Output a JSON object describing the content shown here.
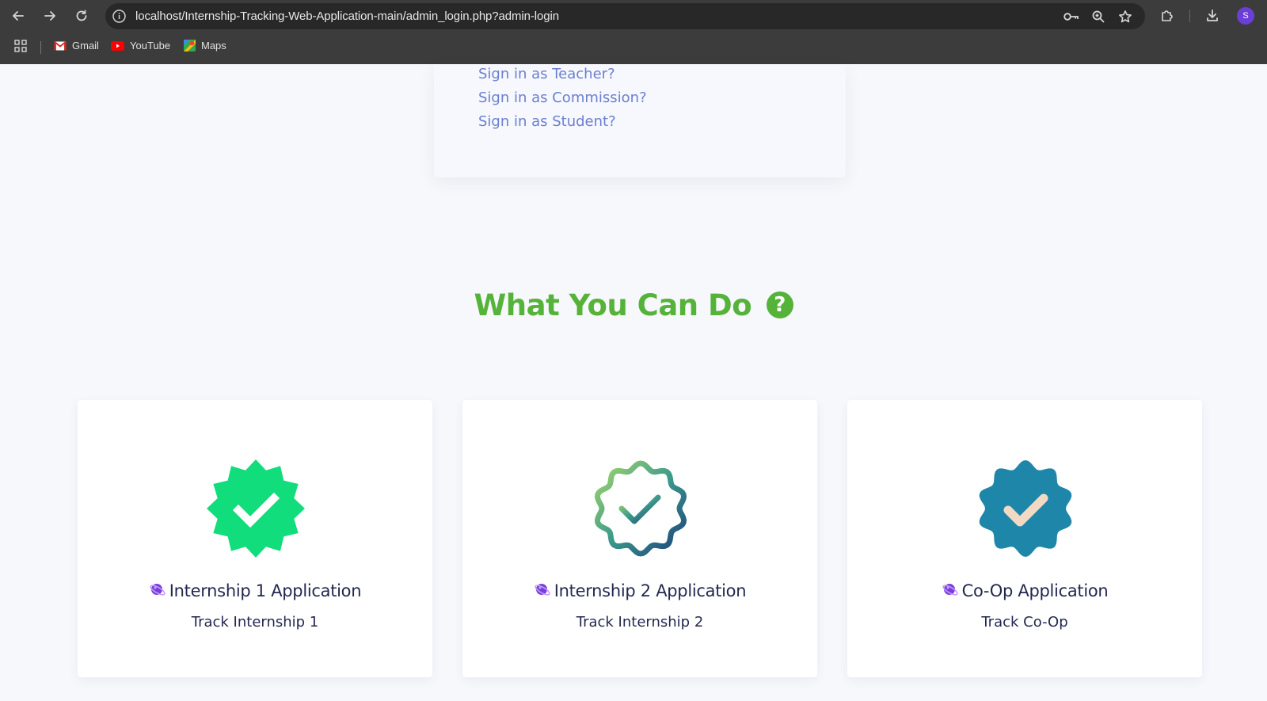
{
  "browser": {
    "url": "localhost/Internship-Tracking-Web-Application-main/admin_login.php?admin-login",
    "avatar_letter": "S",
    "bookmarks": [
      {
        "label": "Gmail",
        "icon": "gmail-icon"
      },
      {
        "label": "YouTube",
        "icon": "youtube-icon"
      },
      {
        "label": "Maps",
        "icon": "maps-icon"
      }
    ]
  },
  "login": {
    "links": [
      "Sign in as Teacher?",
      "Sign in as Commission?",
      "Sign in as Student?"
    ]
  },
  "section": {
    "title": "What You Can Do",
    "title_icon": "question-circle-icon",
    "title_color": "#56b33a"
  },
  "cards": [
    {
      "title": "Internship 1 Application",
      "subtitle": "Track Internship 1",
      "badge": "verified-badge-green-icon",
      "badge_color": "#12dd7c"
    },
    {
      "title": "Internship 2 Application",
      "subtitle": "Track Internship 2",
      "badge": "verified-badge-gradient-outline-icon",
      "badge_color": "#2a7f8c"
    },
    {
      "title": "Co-Op Application",
      "subtitle": "Track Co-Op",
      "badge": "verified-badge-blue-icon",
      "badge_color": "#1e86a8"
    }
  ]
}
